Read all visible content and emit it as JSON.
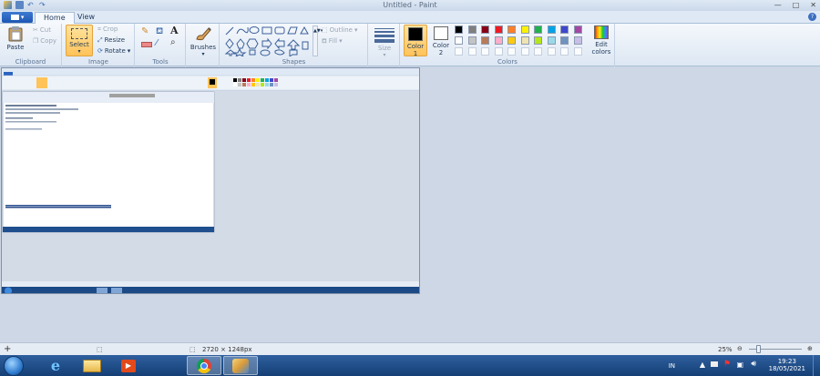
{
  "window": {
    "title": "Untitled - Paint"
  },
  "tabs": {
    "file_label": "▾",
    "home": "Home",
    "view": "View"
  },
  "ribbon": {
    "clipboard": {
      "paste": "Paste",
      "cut": "Cut",
      "copy": "Copy",
      "label": "Clipboard"
    },
    "image": {
      "select": "Select",
      "crop": "Crop",
      "resize": "Resize",
      "rotate": "Rotate",
      "label": "Image"
    },
    "tools": {
      "label": "Tools",
      "text_tool": "A"
    },
    "brushes": {
      "label": "Brushes"
    },
    "shapes": {
      "outline": "Outline",
      "fill": "Fill",
      "label": "Shapes"
    },
    "size": {
      "label": "Size"
    },
    "colors": {
      "color1": "Color 1",
      "color1_line1": "Color",
      "color1_line2": "1",
      "color2_line1": "Color",
      "color2_line2": "2",
      "edit_colors_line1": "Edit",
      "edit_colors_line2": "colors",
      "label": "Colors",
      "color1_value": "#000000",
      "color2_value": "#ffffff",
      "palette_row1": [
        "#000000",
        "#7f7f7f",
        "#880015",
        "#ed1c24",
        "#ff7f27",
        "#fff200",
        "#22b14c",
        "#00a2e8",
        "#3f48cc",
        "#a349a4"
      ],
      "palette_row2": [
        "#ffffff",
        "#c3c3c3",
        "#b97a57",
        "#ffaec9",
        "#ffc90e",
        "#efe4b0",
        "#b5e61d",
        "#99d9ea",
        "#7092be",
        "#c8bfe7"
      ]
    }
  },
  "statusbar": {
    "image_size": "2720 × 1248px",
    "zoom": "25%",
    "zoom_fraction": 0.25
  },
  "taskbar": {
    "language": "IN",
    "time": "19:23",
    "date": "18/05/2021"
  }
}
